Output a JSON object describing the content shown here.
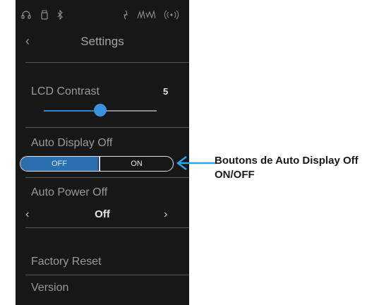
{
  "header": {
    "title": "Settings"
  },
  "lcd_contrast": {
    "label": "LCD Contrast",
    "value": "5",
    "level_fraction": 0.5
  },
  "auto_display_off": {
    "label": "Auto Display Off",
    "off_label": "OFF",
    "on_label": "ON",
    "selected": "OFF"
  },
  "auto_power_off": {
    "label": "Auto Power Off",
    "value": "Off"
  },
  "menu": {
    "factory_reset": "Factory Reset",
    "version": "Version"
  },
  "callout": {
    "text": "Boutons de Auto Display Off ON/OFF"
  },
  "colors": {
    "accent": "#2f86d1",
    "screen_bg": "#171717",
    "callout_arrow": "#2aa7e6"
  },
  "icons": [
    "headphones-icon",
    "usb-icon",
    "bluetooth-icon",
    "microphone-icon",
    "mic-level-icon",
    "wireless-icon"
  ]
}
